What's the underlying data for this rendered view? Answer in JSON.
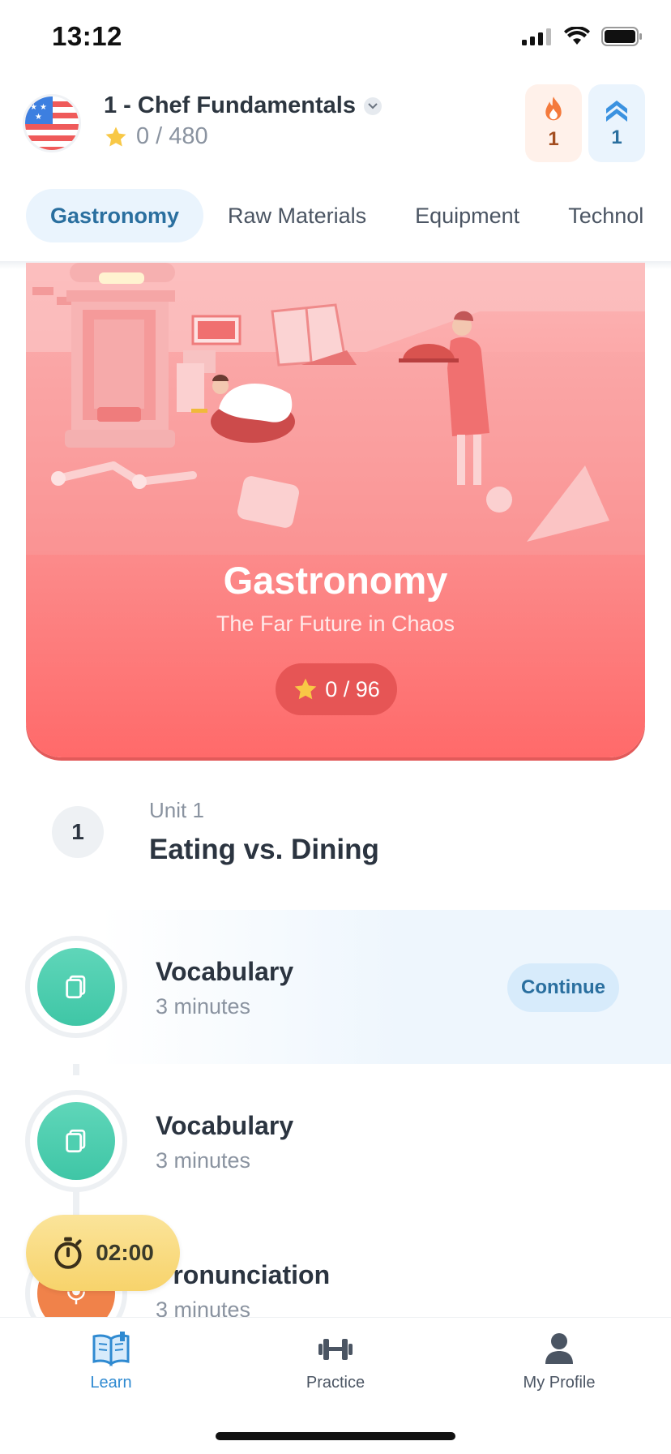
{
  "status_bar": {
    "time": "13:12"
  },
  "header": {
    "course_title": "1 - Chef Fundamentals",
    "course_stars": "0 / 480",
    "streak_count": "1",
    "league_count": "1"
  },
  "tabs": [
    {
      "label": "Gastronomy",
      "active": true
    },
    {
      "label": "Raw Materials",
      "active": false
    },
    {
      "label": "Equipment",
      "active": false
    },
    {
      "label": "Technol",
      "active": false
    }
  ],
  "hero": {
    "title": "Gastronomy",
    "subtitle": "The Far Future in Chaos",
    "stars": "0 / 96"
  },
  "unit": {
    "number": "1",
    "kicker": "Unit 1",
    "title": "Eating vs. Dining"
  },
  "lessons": [
    {
      "name": "Vocabulary",
      "duration": "3 minutes",
      "icon": "cards-icon",
      "color": "#4fcfb0",
      "current": true,
      "action": "Continue"
    },
    {
      "name": "Vocabulary",
      "duration": "3 minutes",
      "icon": "cards-icon",
      "color": "#4fcfb0",
      "current": false
    },
    {
      "name": "Pronunciation",
      "duration": "3 minutes",
      "icon": "microphone-icon",
      "color": "#f0824a",
      "current": false
    }
  ],
  "timer": {
    "value": "02:00"
  },
  "bottom_nav": [
    {
      "label": "Learn",
      "icon": "book-icon",
      "active": true
    },
    {
      "label": "Practice",
      "icon": "dumbbell-icon",
      "active": false
    },
    {
      "label": "My Profile",
      "icon": "person-icon",
      "active": false
    }
  ],
  "colors": {
    "accent_blue": "#2f8ad1",
    "hero_red": "#ff6a6a",
    "lesson_green": "#4fcfb0",
    "timer_yellow": "#f7d36b"
  }
}
